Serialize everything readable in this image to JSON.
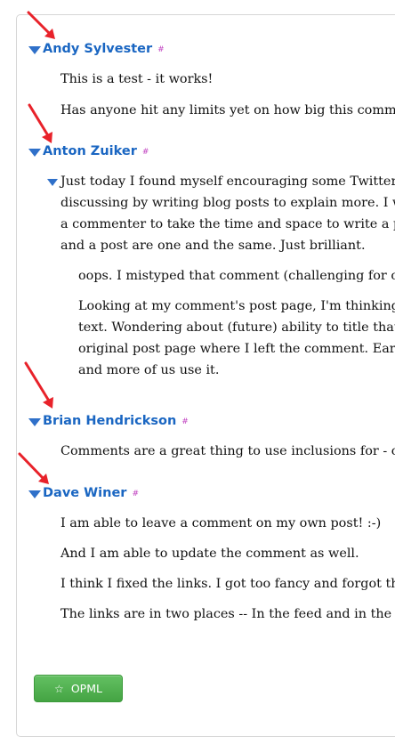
{
  "comments": [
    {
      "author": "Andy Sylvester",
      "permalink": "#",
      "paragraphs": [
        "This is a test - it works!",
        "Has anyone hit any limits yet on how big this comme"
      ]
    },
    {
      "author": "Anton Zuiker",
      "permalink": "#",
      "paragraphs": [
        "Just today I found myself encouraging some Twitter",
        "discussing by writing blog posts to explain more. I w",
        "a commenter to take the time and space to write a po",
        "and a post are one and the same. Just brilliant."
      ],
      "replies": [
        "oops. I mistyped that comment (challenging for ch",
        "Looking at my comment's post page, I'm thinking",
        "text. Wondering about (future) ability to title that",
        "original post page where I left the comment. Early",
        "and more of us use it."
      ]
    },
    {
      "author": "Brian Hendrickson",
      "permalink": "#",
      "paragraphs": [
        "Comments are a great thing to use inclusions for - ca"
      ]
    },
    {
      "author": "Dave Winer",
      "permalink": "#",
      "paragraphs": [
        "I am able to leave a comment on my own post! :-)",
        "And I am able to update the comment as well.",
        "I think I fixed the links. I got too fancy and forgot tha",
        "The links are in two places -- In the feed and in the O"
      ]
    }
  ],
  "opml_button": {
    "label": "OPML",
    "icon": "star-icon"
  },
  "colors": {
    "link": "#1a66c2",
    "triangle": "#2f70c9",
    "hash": "#c040c0",
    "button": "#4cae4b",
    "arrow": "#e8222a"
  }
}
